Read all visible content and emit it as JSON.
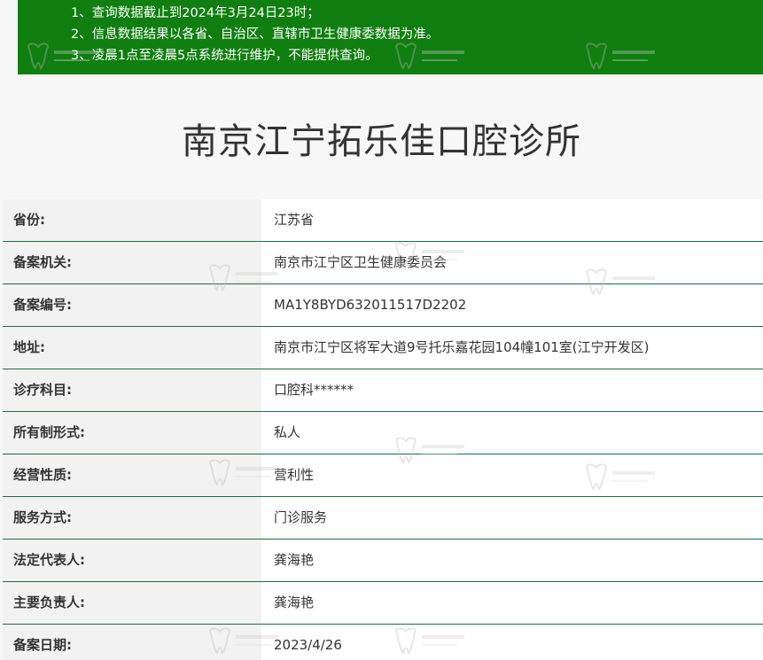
{
  "notice": {
    "lines": [
      "1、查询数据截止到2024年3月24日23时；",
      "2、信息数据结果以各省、自治区、直辖市卫生健康委数据为准。",
      "3、凌晨1点至凌晨5点系统进行维护，不能提供查询。"
    ]
  },
  "title": "南京江宁拓乐佳口腔诊所",
  "rows": [
    {
      "label": "省份:",
      "value": "江苏省"
    },
    {
      "label": "备案机关:",
      "value": "南京市江宁区卫生健康委员会"
    },
    {
      "label": "备案编号:",
      "value": "MA1Y8BYD632011517D2202"
    },
    {
      "label": "地址:",
      "value": "南京市江宁区将军大道9号托乐嘉花园104幢101室(江宁开发区)"
    },
    {
      "label": "诊疗科目:",
      "value": "口腔科******"
    },
    {
      "label": "所有制形式:",
      "value": "私人"
    },
    {
      "label": "经营性质:",
      "value": "营利性"
    },
    {
      "label": "服务方式:",
      "value": "门诊服务"
    },
    {
      "label": "法定代表人:",
      "value": "龚海艳"
    },
    {
      "label": "主要负责人:",
      "value": "龚海艳"
    },
    {
      "label": "备案日期:",
      "value": "2023/4/26"
    }
  ],
  "colors": {
    "notice_bg": "#107e10",
    "row_border": "#1f6b3f"
  },
  "watermark_icon": "tooth-logo-watermark"
}
